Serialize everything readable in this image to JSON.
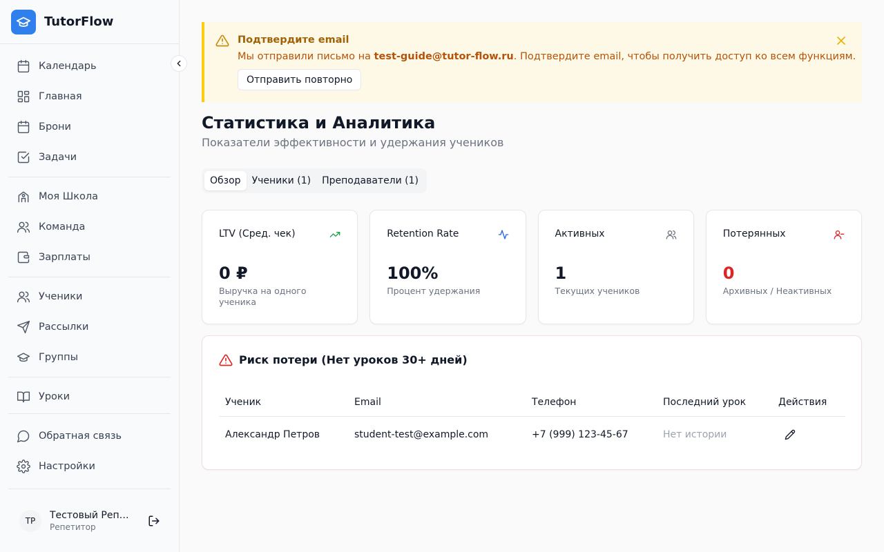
{
  "brand": {
    "name": "TutorFlow",
    "logo_icon": "graduation-cap-icon",
    "accent": "#2f80ed"
  },
  "sidebar": {
    "groups": [
      [
        {
          "label": "Календарь",
          "icon": "calendar-icon"
        },
        {
          "label": "Главная",
          "icon": "dashboard-icon"
        },
        {
          "label": "Брони",
          "icon": "calendar-icon"
        },
        {
          "label": "Задачи",
          "icon": "checkbox-icon"
        }
      ],
      [
        {
          "label": "Моя Школа",
          "icon": "school-icon"
        },
        {
          "label": "Команда",
          "icon": "users-icon"
        },
        {
          "label": "Зарплаты",
          "icon": "wallet-icon"
        }
      ],
      [
        {
          "label": "Ученики",
          "icon": "users-icon"
        },
        {
          "label": "Рассылки",
          "icon": "send-icon"
        },
        {
          "label": "Группы",
          "icon": "graduation-cap-icon"
        }
      ],
      [
        {
          "label": "Уроки",
          "icon": "book-icon"
        }
      ],
      [
        {
          "label": "Обратная связь",
          "icon": "message-icon"
        },
        {
          "label": "Настройки",
          "icon": "gear-icon"
        }
      ]
    ],
    "user": {
      "initials": "TP",
      "name": "Тестовый Репетитор",
      "role": "Репетитор"
    }
  },
  "alert": {
    "title": "Подтвердите email",
    "text_before": "Мы отправили письмо на ",
    "email": "test-guide@tutor-flow.ru",
    "text_after": ". Подтвердите email, чтобы получить доступ ко всем функциям.",
    "button": "Отправить повторно",
    "color": "#a16207"
  },
  "page": {
    "title": "Статистика и Аналитика",
    "subtitle": "Показатели эффективности и удержания учеников"
  },
  "tabs": [
    "Обзор",
    "Ученики (1)",
    "Преподаватели (1)"
  ],
  "cards": [
    {
      "title": "LTV (Сред. чек)",
      "value": "0 ₽",
      "desc": "Выручка на одного ученика",
      "icon": "trending-up-icon",
      "icon_color": "#16a34a"
    },
    {
      "title": "Retention Rate",
      "value": "100%",
      "desc": "Процент удержания",
      "icon": "activity-icon",
      "icon_color": "#2563eb"
    },
    {
      "title": "Активных",
      "value": "1",
      "desc": "Текущих учеников",
      "icon": "users-icon",
      "icon_color": "#6b7280"
    },
    {
      "title": "Потерянных",
      "value": "0",
      "desc": "Архивных / Неактивных",
      "icon": "user-minus-icon",
      "icon_color": "#dc2626"
    }
  ],
  "risk": {
    "title": "Риск потери (Нет уроков 30+ дней)",
    "columns": [
      "Ученик",
      "Email",
      "Телефон",
      "Последний урок",
      "Действия"
    ],
    "rows": [
      {
        "student": "Александр Петров",
        "email": "student-test@example.com",
        "phone": "+7 (999) 123-45-67",
        "last_lesson": "Нет истории",
        "action_icon": "pencil-icon"
      }
    ]
  }
}
